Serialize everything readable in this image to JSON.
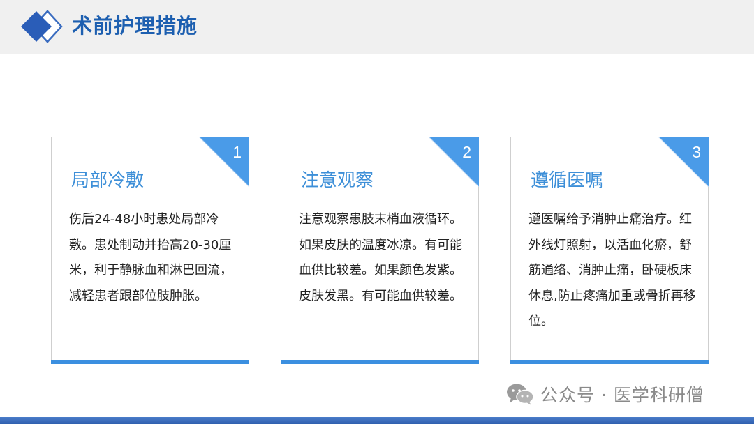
{
  "header": {
    "title": "术前护理措施"
  },
  "cards": [
    {
      "number": "1",
      "heading": "局部冷敷",
      "body": "伤后24-48小时患处局部冷敷。患处制动并抬高20-30厘米，利于静脉血和淋巴回流，减轻患者跟部位肢肿胀。"
    },
    {
      "number": "2",
      "heading": "注意观察",
      "body": "注意观察患肢末梢血液循环。如果皮肤的温度冰凉。有可能血供比较差。如果颜色发紫。皮肤发黑。有可能血供较差。"
    },
    {
      "number": "3",
      "heading": "遵循医嘱",
      "body": "遵医嘱给予消肿止痛治疗。红外线灯照射，以活血化瘀，舒筋通络、消肿止痛，卧硬板床休息,防止疼痛加重或骨折再移位。"
    }
  ],
  "watermark": {
    "text": "公众号 · 医学科研僧"
  },
  "colors": {
    "title": "#1d5fb0",
    "accent": "#3b8fe0",
    "heading": "#3d8fd8",
    "corner": "#4a9be8"
  }
}
